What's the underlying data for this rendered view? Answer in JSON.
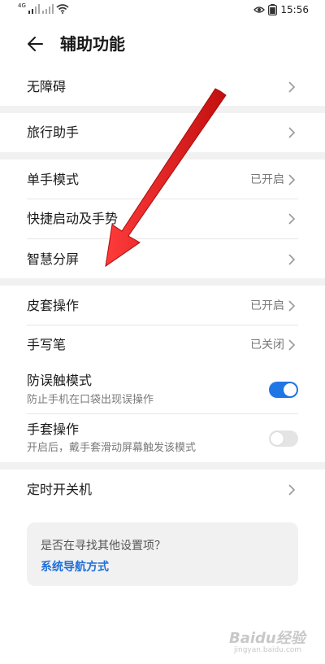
{
  "status_bar": {
    "signal_label": "4G",
    "time": "15:56"
  },
  "header": {
    "title": "辅助功能"
  },
  "sections": {
    "accessibility": {
      "label": "无障碍"
    },
    "travel": {
      "label": "旅行助手"
    },
    "one_hand": {
      "label": "单手模式",
      "value": "已开启"
    },
    "shortcuts": {
      "label": "快捷启动及手势"
    },
    "split_screen": {
      "label": "智慧分屏"
    },
    "cover": {
      "label": "皮套操作",
      "value": "已开启"
    },
    "stylus": {
      "label": "手写笔",
      "value": "已关闭"
    },
    "pocket_mode": {
      "label": "防误触模式",
      "sublabel": "防止手机在口袋出现误操作",
      "enabled": true
    },
    "glove_mode": {
      "label": "手套操作",
      "sublabel": "开启后，戴手套滑动屏幕触发该模式",
      "enabled": false
    },
    "scheduled_power": {
      "label": "定时开关机"
    }
  },
  "suggestion": {
    "question": "是否在寻找其他设置项？",
    "link": "系统导航方式"
  },
  "watermark": {
    "main": "Baidu经验",
    "sub": "jingyan.baidu.com"
  },
  "colors": {
    "accent": "#1f77e6",
    "link": "#1f6fd8",
    "annotation_arrow": "#e01c1c"
  }
}
